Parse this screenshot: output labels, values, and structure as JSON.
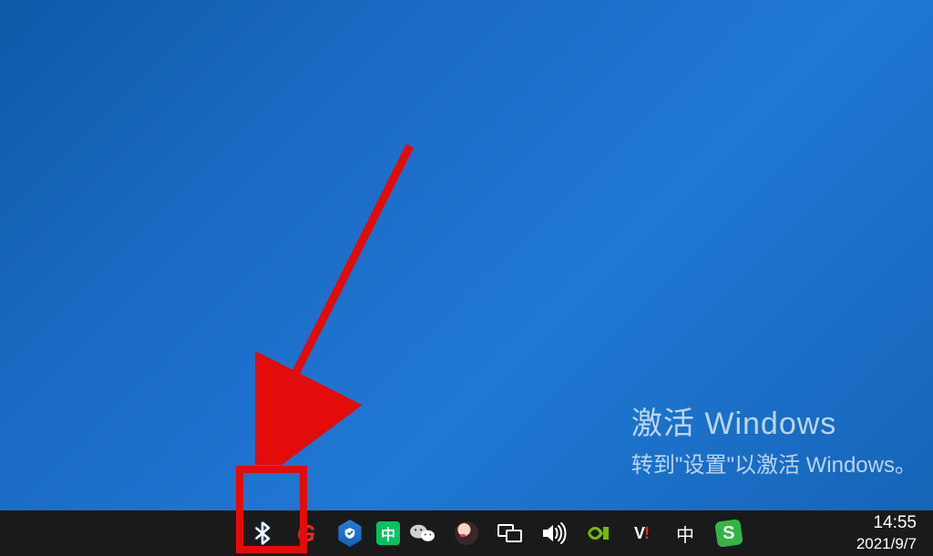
{
  "watermark": {
    "title": "激活 Windows",
    "subtitle": "转到\"设置\"以激活 Windows。"
  },
  "annotation": {
    "arrow_color": "#e40b0b",
    "highlight_color": "#e40b0b"
  },
  "taskbar": {
    "tray_icons": [
      {
        "name": "bluetooth-icon",
        "label": "Bluetooth"
      },
      {
        "name": "game-g-icon",
        "label": "G"
      },
      {
        "name": "tencent-manager-icon",
        "label": "Tencent"
      },
      {
        "name": "wechat-zhong-icon",
        "label": "中"
      },
      {
        "name": "wechat-icon",
        "label": "WeChat"
      },
      {
        "name": "media-app-icon",
        "label": "MediaApp"
      },
      {
        "name": "network-icon",
        "label": "Network"
      },
      {
        "name": "volume-icon",
        "label": "Volume"
      },
      {
        "name": "nvidia-icon",
        "label": "NVIDIA"
      },
      {
        "name": "vi-app-icon",
        "label": "V!"
      },
      {
        "name": "ime-indicator",
        "label": "中"
      },
      {
        "name": "sogou-ime-icon",
        "label": "S"
      }
    ],
    "clock": {
      "time": "14:55",
      "date": "2021/9/7"
    }
  }
}
